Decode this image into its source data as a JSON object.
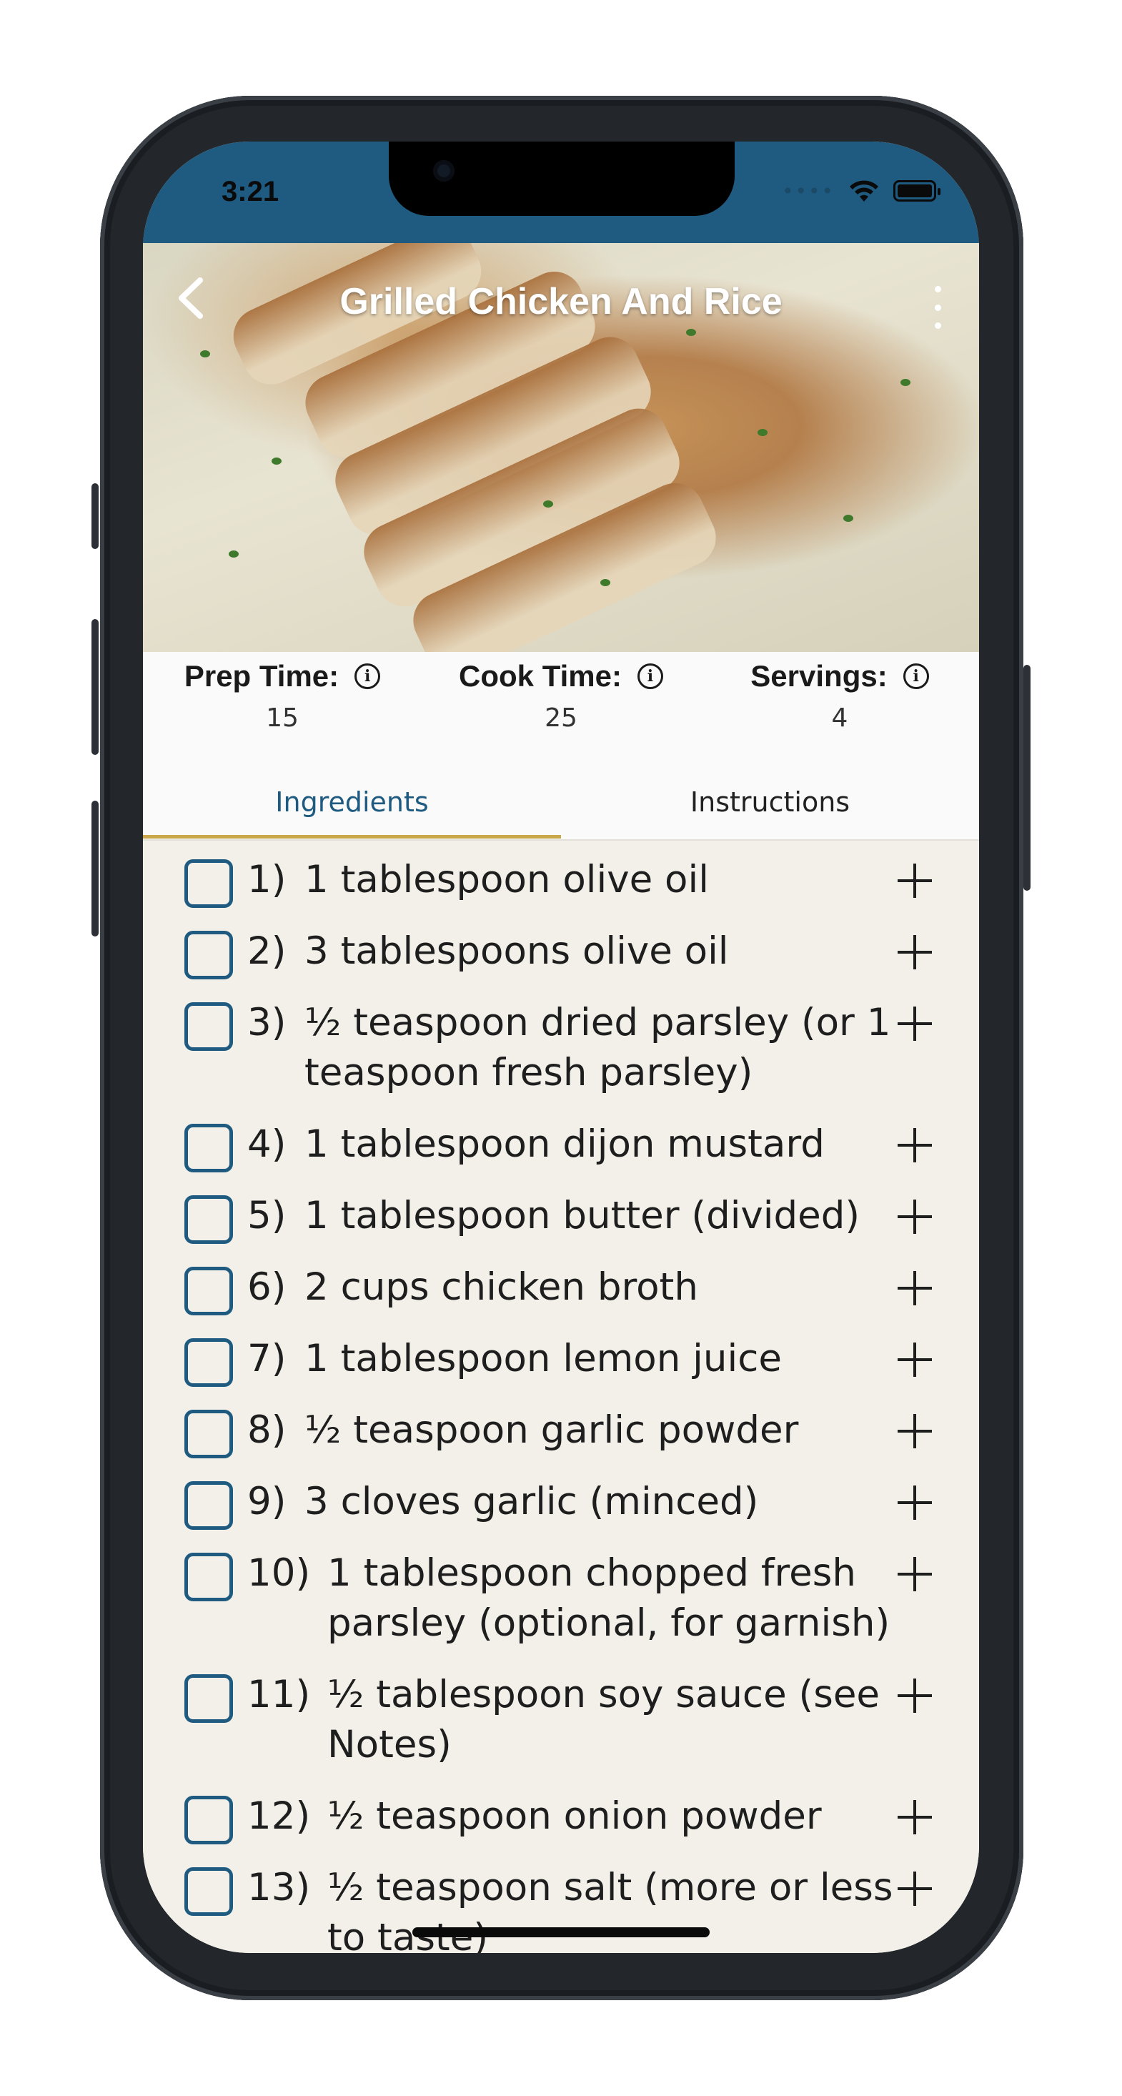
{
  "status": {
    "time": "3:21"
  },
  "header": {
    "title": "Grilled Chicken And Rice"
  },
  "info": [
    {
      "label": "Prep Time:",
      "value": "15"
    },
    {
      "label": "Cook Time:",
      "value": "25"
    },
    {
      "label": "Servings:",
      "value": "4"
    }
  ],
  "tabs": {
    "ingredients": "Ingredients",
    "instructions": "Instructions"
  },
  "ingredients": [
    {
      "num": "1)",
      "lines": [
        "1 tablespoon olive oil"
      ]
    },
    {
      "num": "2)",
      "lines": [
        "3 tablespoons olive oil"
      ]
    },
    {
      "num": "3)",
      "lines": [
        "½ teaspoon dried parsley (or 1",
        "teaspoon fresh parsley)"
      ]
    },
    {
      "num": "4)",
      "lines": [
        "1 tablespoon dijon mustard"
      ]
    },
    {
      "num": "5)",
      "lines": [
        "1 tablespoon butter (divided)"
      ]
    },
    {
      "num": "6)",
      "lines": [
        "2 cups chicken broth"
      ]
    },
    {
      "num": "7)",
      "lines": [
        "1 tablespoon lemon juice"
      ]
    },
    {
      "num": "8)",
      "lines": [
        "½ teaspoon garlic powder"
      ]
    },
    {
      "num": "9)",
      "lines": [
        "3 cloves garlic (minced)"
      ]
    },
    {
      "num": "10)",
      "lines": [
        "1 tablespoon  chopped fresh",
        "parsley (optional, for garnish)"
      ]
    },
    {
      "num": "11)",
      "lines": [
        "½ tablespoon soy sauce (see",
        "Notes)"
      ]
    },
    {
      "num": "12)",
      "lines": [
        "½ teaspoon onion powder"
      ]
    },
    {
      "num": "13)",
      "lines": [
        "½ teaspoon salt (more or less",
        "to taste)"
      ]
    }
  ]
}
